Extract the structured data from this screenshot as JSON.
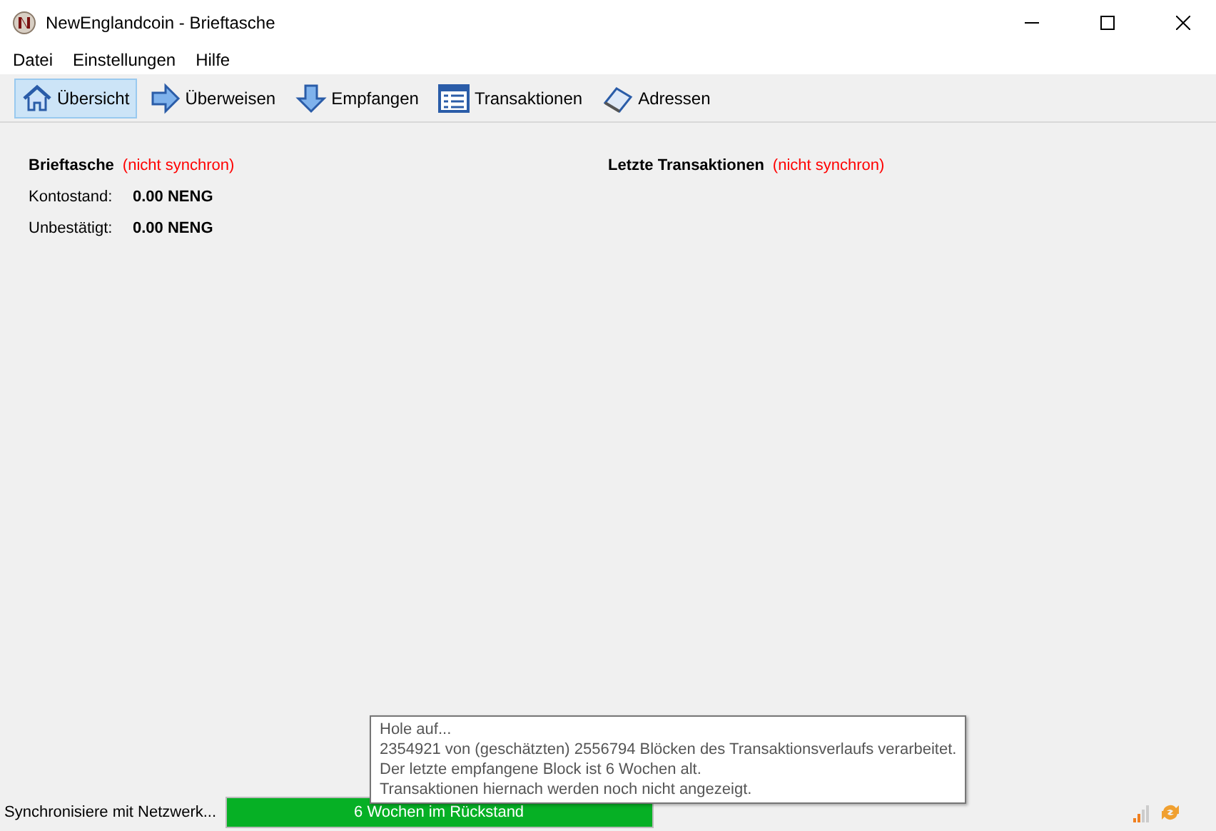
{
  "window": {
    "title": "NewEnglandcoin - Brieftasche"
  },
  "menu": [
    "Datei",
    "Einstellungen",
    "Hilfe"
  ],
  "toolbar": [
    {
      "label": "Übersicht",
      "selected": true
    },
    {
      "label": "Überweisen",
      "selected": false
    },
    {
      "label": "Empfangen",
      "selected": false
    },
    {
      "label": "Transaktionen",
      "selected": false
    },
    {
      "label": "Adressen",
      "selected": false
    }
  ],
  "wallet": {
    "title": "Brieftasche",
    "sync_note": "(nicht synchron)",
    "rows": [
      {
        "label": "Kontostand:",
        "value": "0.00 NENG"
      },
      {
        "label": "Unbestätigt:",
        "value": "0.00 NENG"
      }
    ]
  },
  "recent": {
    "title": "Letzte Transaktionen",
    "sync_note": "(nicht synchron)"
  },
  "status_bar": {
    "text": "Synchronisiere mit Netzwerk...",
    "progress": {
      "level": 1,
      "text": "6 Wochen im Rückstand"
    }
  },
  "tooltip": [
    "Hole auf...",
    "2354921 von (geschätzten) 2556794 Blöcken des Transaktionsverlaufs verarbeitet.",
    "Der letzte empfangene Block ist 6 Wochen alt.",
    "Transaktionen hiernach werden noch nicht angezeigt."
  ]
}
